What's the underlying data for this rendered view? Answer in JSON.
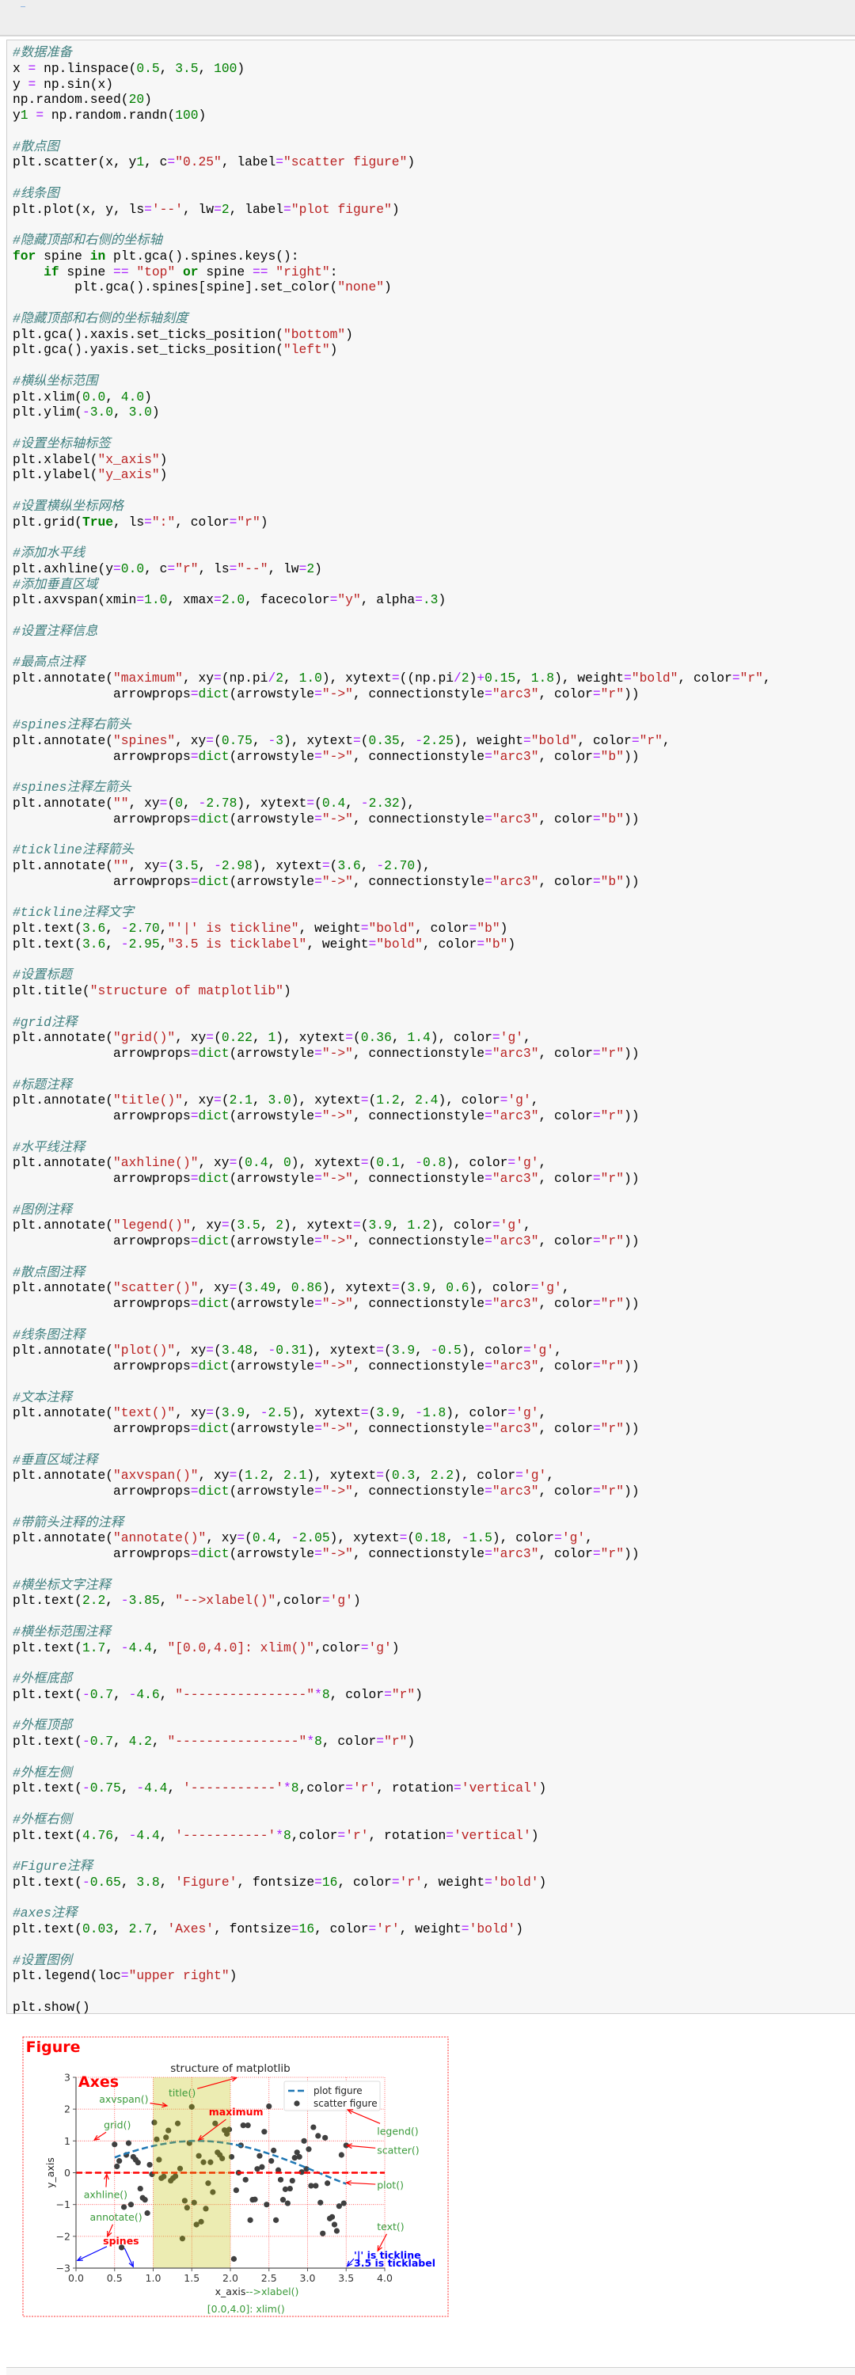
{
  "code": {
    "lines": [
      "#数据准备",
      "x = np.linspace(0.5, 3.5, 100)",
      "y = np.sin(x)",
      "np.random.seed(20)",
      "y1 = np.random.randn(100)",
      "",
      "#散点图",
      "plt.scatter(x, y1, c=\"0.25\", label=\"scatter figure\")",
      "",
      "#线条图",
      "plt.plot(x, y, ls='--', lw=2, label=\"plot figure\")",
      "",
      "#隐藏顶部和右侧的坐标轴",
      "for spine in plt.gca().spines.keys():",
      "    if spine == \"top\" or spine == \"right\":",
      "        plt.gca().spines[spine].set_color(\"none\")",
      "",
      "#隐藏顶部和右侧的坐标轴刻度",
      "plt.gca().xaxis.set_ticks_position(\"bottom\")",
      "plt.gca().yaxis.set_ticks_position(\"left\")",
      "",
      "#横纵坐标范围",
      "plt.xlim(0.0, 4.0)",
      "plt.ylim(-3.0, 3.0)",
      "",
      "#设置坐标轴标签",
      "plt.xlabel(\"x_axis\")",
      "plt.ylabel(\"y_axis\")",
      "",
      "#设置横纵坐标网格",
      "plt.grid(True, ls=\":\", color=\"r\")",
      "",
      "#添加水平线",
      "plt.axhline(y=0.0, c=\"r\", ls=\"--\", lw=2)",
      "#添加垂直区域",
      "plt.axvspan(xmin=1.0, xmax=2.0, facecolor=\"y\", alpha=.3)",
      "",
      "#设置注释信息",
      "",
      "#最高点注释",
      "plt.annotate(\"maximum\", xy=(np.pi/2, 1.0), xytext=((np.pi/2)+0.15, 1.8), weight=\"bold\", color=\"r\",",
      "             arrowprops=dict(arrowstyle=\"->\", connectionstyle=\"arc3\", color=\"r\"))",
      "",
      "#spines注释右箭头",
      "plt.annotate(\"spines\", xy=(0.75, -3), xytext=(0.35, -2.25), weight=\"bold\", color=\"r\",",
      "             arrowprops=dict(arrowstyle=\"->\", connectionstyle=\"arc3\", color=\"b\"))",
      "",
      "#spines注释左箭头",
      "plt.annotate(\"\", xy=(0, -2.78), xytext=(0.4, -2.32),",
      "             arrowprops=dict(arrowstyle=\"->\", connectionstyle=\"arc3\", color=\"b\"))",
      "",
      "#tickline注释箭头",
      "plt.annotate(\"\", xy=(3.5, -2.98), xytext=(3.6, -2.70),",
      "             arrowprops=dict(arrowstyle=\"->\", connectionstyle=\"arc3\", color=\"b\"))",
      "",
      "#tickline注释文字",
      "plt.text(3.6, -2.70,\"'|' is tickline\", weight=\"bold\", color=\"b\")",
      "plt.text(3.6, -2.95,\"3.5 is ticklabel\", weight=\"bold\", color=\"b\")",
      "",
      "#设置标题",
      "plt.title(\"structure of matplotlib\")",
      "",
      "#grid注释",
      "plt.annotate(\"grid()\", xy=(0.22, 1), xytext=(0.36, 1.4), color='g',",
      "             arrowprops=dict(arrowstyle=\"->\", connectionstyle=\"arc3\", color=\"r\"))",
      "",
      "#标题注释",
      "plt.annotate(\"title()\", xy=(2.1, 3.0), xytext=(1.2, 2.4), color='g',",
      "             arrowprops=dict(arrowstyle=\"->\", connectionstyle=\"arc3\", color=\"r\"))",
      "",
      "#水平线注释",
      "plt.annotate(\"axhline()\", xy=(0.4, 0), xytext=(0.1, -0.8), color='g',",
      "             arrowprops=dict(arrowstyle=\"->\", connectionstyle=\"arc3\", color=\"r\"))",
      "",
      "#图例注释",
      "plt.annotate(\"legend()\", xy=(3.5, 2), xytext=(3.9, 1.2), color='g',",
      "             arrowprops=dict(arrowstyle=\"->\", connectionstyle=\"arc3\", color=\"r\"))",
      "",
      "#散点图注释",
      "plt.annotate(\"scatter()\", xy=(3.49, 0.86), xytext=(3.9, 0.6), color='g',",
      "             arrowprops=dict(arrowstyle=\"->\", connectionstyle=\"arc3\", color=\"r\"))",
      "",
      "#线条图注释",
      "plt.annotate(\"plot()\", xy=(3.48, -0.31), xytext=(3.9, -0.5), color='g',",
      "             arrowprops=dict(arrowstyle=\"->\", connectionstyle=\"arc3\", color=\"r\"))",
      "",
      "#文本注释",
      "plt.annotate(\"text()\", xy=(3.9, -2.5), xytext=(3.9, -1.8), color='g',",
      "             arrowprops=dict(arrowstyle=\"->\", connectionstyle=\"arc3\", color=\"r\"))",
      "",
      "#垂直区域注释",
      "plt.annotate(\"axvspan()\", xy=(1.2, 2.1), xytext=(0.3, 2.2), color='g',",
      "             arrowprops=dict(arrowstyle=\"->\", connectionstyle=\"arc3\", color=\"r\"))",
      "",
      "#带箭头注释的注释",
      "plt.annotate(\"annotate()\", xy=(0.4, -2.05), xytext=(0.18, -1.5), color='g',",
      "             arrowprops=dict(arrowstyle=\"->\", connectionstyle=\"arc3\", color=\"r\"))",
      "",
      "#横坐标文字注释",
      "plt.text(2.2, -3.85, \"-->xlabel()\",color='g')",
      "",
      "#横坐标范围注释",
      "plt.text(1.7, -4.4, \"[0.0,4.0]: xlim()\",color='g')",
      "",
      "#外框底部",
      "plt.text(-0.7, -4.6, \"----------------\"*8, color=\"r\")",
      "",
      "#外框顶部",
      "plt.text(-0.7, 4.2, \"----------------\"*8, color=\"r\")",
      "",
      "#外框左侧",
      "plt.text(-0.75, -4.4, '-----------'*8,color='r', rotation='vertical')",
      "",
      "#外框右侧",
      "plt.text(4.76, -4.4, '-----------'*8,color='r', rotation='vertical')",
      "",
      "#Figure注释",
      "plt.text(-0.65, 3.8, 'Figure', fontsize=16, color='r', weight='bold')",
      "",
      "#axes注释",
      "plt.text(0.03, 2.7, 'Axes', fontsize=16, color='r', weight='bold')",
      "",
      "#设置图例",
      "plt.legend(loc=\"upper right\")",
      "",
      "plt.show()"
    ]
  },
  "chart_data": {
    "type": "scatter",
    "title": "structure of matplotlib",
    "xlabel": "x_axis",
    "ylabel": "y_axis",
    "xlim": [
      0.0,
      4.0
    ],
    "ylim": [
      -3.0,
      3.0
    ],
    "xticks": [
      "0.0",
      "0.5",
      "1.0",
      "1.5",
      "2.0",
      "2.5",
      "3.0",
      "3.5",
      "4.0"
    ],
    "yticks": [
      "−3",
      "−2",
      "−1",
      "0",
      "1",
      "2",
      "3"
    ],
    "grid": true,
    "grid_color": "#ff0000",
    "legend": {
      "placement": "upper right",
      "entries": [
        "plot figure",
        "scatter figure"
      ]
    },
    "colors": {
      "r": "#ff0000",
      "g": "#3a9a3a",
      "b": "#0000ff",
      "scatter": "#404040",
      "line": "#1f77b4",
      "span": "#bfbf00",
      "spine": "#555555"
    },
    "scatter": {
      "name": "scatter figure",
      "x_linspace": [
        0.5,
        3.5,
        100
      ],
      "y": [
        0.89,
        0.2,
        0.37,
        -2.35,
        -1.08,
        0.56,
        0.93,
        -1.0,
        0.5,
        0.41,
        0.32,
        -0.5,
        -0.79,
        -0.85,
        -1.27,
        0.25,
        -0.05,
        1.58,
        1.05,
        0.41,
        -0.17,
        -0.12,
        1.11,
        1.33,
        -0.25,
        -0.17,
        -0.11,
        1.55,
        0.13,
        -2.07,
        -0.88,
        -1.1,
        0.93,
        2.07,
        -0.94,
        -1.63,
        0.53,
        -1.54,
        0.33,
        -1.13,
        -0.33,
        0.33,
        -0.61,
        1.55,
        0.64,
        0.56,
        0.45,
        1.34,
        1.22,
        1.36,
        0.5,
        -2.71,
        -0.55,
        0.0,
        0.86,
        1.49,
        -0.22,
        1.49,
        -1.49,
        -0.85,
        -0.84,
        0.12,
        0.53,
        0.18,
        1.29,
        -1.0,
        2.09,
        0.37,
        0.7,
        -1.49,
        0.08,
        -0.22,
        -0.85,
        -0.52,
        -0.96,
        -0.5,
        -0.25,
        0.47,
        0.64,
        0.5,
        0.02,
        1.0,
        0.12,
        0.74,
        -0.41,
        1.43,
        -0.41,
        1.16,
        -0.94,
        -1.91,
        1.1,
        -0.33,
        -1.44,
        -1.39,
        -1.63,
        -1.83,
        -1.05,
        0.56,
        -0.96,
        0.86
      ]
    },
    "line": {
      "name": "plot figure",
      "function": "sin",
      "style": "dashed"
    },
    "axhline": {
      "y": 0.0,
      "style": "dashed",
      "color": "r"
    },
    "axvspan": {
      "xmin": 1.0,
      "xmax": 2.0,
      "alpha": 0.3
    },
    "annotations": [
      {
        "text": "maximum",
        "xy": [
          1.5708,
          1.0
        ],
        "xytext": [
          1.7208,
          1.8
        ],
        "color": "r",
        "bold": true,
        "arrow": "r"
      },
      {
        "text": "spines",
        "xy": [
          0.75,
          -3
        ],
        "xytext": [
          0.35,
          -2.25
        ],
        "color": "r",
        "bold": true,
        "arrow": "b"
      },
      {
        "text": "",
        "xy": [
          0,
          -2.78
        ],
        "xytext": [
          0.4,
          -2.32
        ],
        "color": "r",
        "bold": false,
        "arrow": "b"
      },
      {
        "text": "",
        "xy": [
          3.5,
          -2.98
        ],
        "xytext": [
          3.6,
          -2.7
        ],
        "color": "r",
        "bold": false,
        "arrow": "b"
      },
      {
        "text": "grid()",
        "xy": [
          0.22,
          1
        ],
        "xytext": [
          0.36,
          1.4
        ],
        "color": "g",
        "bold": false,
        "arrow": "r"
      },
      {
        "text": "title()",
        "xy": [
          2.1,
          3.0
        ],
        "xytext": [
          1.2,
          2.4
        ],
        "color": "g",
        "bold": false,
        "arrow": "r"
      },
      {
        "text": "axhline()",
        "xy": [
          0.4,
          0
        ],
        "xytext": [
          0.1,
          -0.8
        ],
        "color": "g",
        "bold": false,
        "arrow": "r"
      },
      {
        "text": "legend()",
        "xy": [
          3.5,
          2
        ],
        "xytext": [
          3.9,
          1.2
        ],
        "color": "g",
        "bold": false,
        "arrow": "r"
      },
      {
        "text": "scatter()",
        "xy": [
          3.49,
          0.86
        ],
        "xytext": [
          3.9,
          0.6
        ],
        "color": "g",
        "bold": false,
        "arrow": "r"
      },
      {
        "text": "plot()",
        "xy": [
          3.48,
          -0.31
        ],
        "xytext": [
          3.9,
          -0.5
        ],
        "color": "g",
        "bold": false,
        "arrow": "r"
      },
      {
        "text": "text()",
        "xy": [
          3.9,
          -2.5
        ],
        "xytext": [
          3.9,
          -1.8
        ],
        "color": "g",
        "bold": false,
        "arrow": "r"
      },
      {
        "text": "axvspan()",
        "xy": [
          1.2,
          2.1
        ],
        "xytext": [
          0.3,
          2.2
        ],
        "color": "g",
        "bold": false,
        "arrow": "r"
      },
      {
        "text": "annotate()",
        "xy": [
          0.4,
          -2.05
        ],
        "xytext": [
          0.18,
          -1.5
        ],
        "color": "g",
        "bold": false,
        "arrow": "r"
      }
    ],
    "texts": [
      {
        "text": "'|' is tickline",
        "x": 3.6,
        "y": -2.7,
        "color": "b",
        "bold": true,
        "big": false
      },
      {
        "text": "3.5 is ticklabel",
        "x": 3.6,
        "y": -2.95,
        "color": "b",
        "bold": true,
        "big": false
      },
      {
        "text": "-->xlabel()",
        "x": 2.2,
        "y": -3.85,
        "color": "g",
        "bold": false,
        "big": false
      },
      {
        "text": "[0.0,4.0]: xlim()",
        "x": 1.7,
        "y": -4.4,
        "color": "g",
        "bold": false,
        "big": false
      },
      {
        "text": "Figure",
        "x": -0.65,
        "y": 3.8,
        "color": "r",
        "bold": true,
        "big": true
      },
      {
        "text": "Axes",
        "x": 0.03,
        "y": 2.7,
        "color": "r",
        "bold": true,
        "big": true
      }
    ]
  }
}
